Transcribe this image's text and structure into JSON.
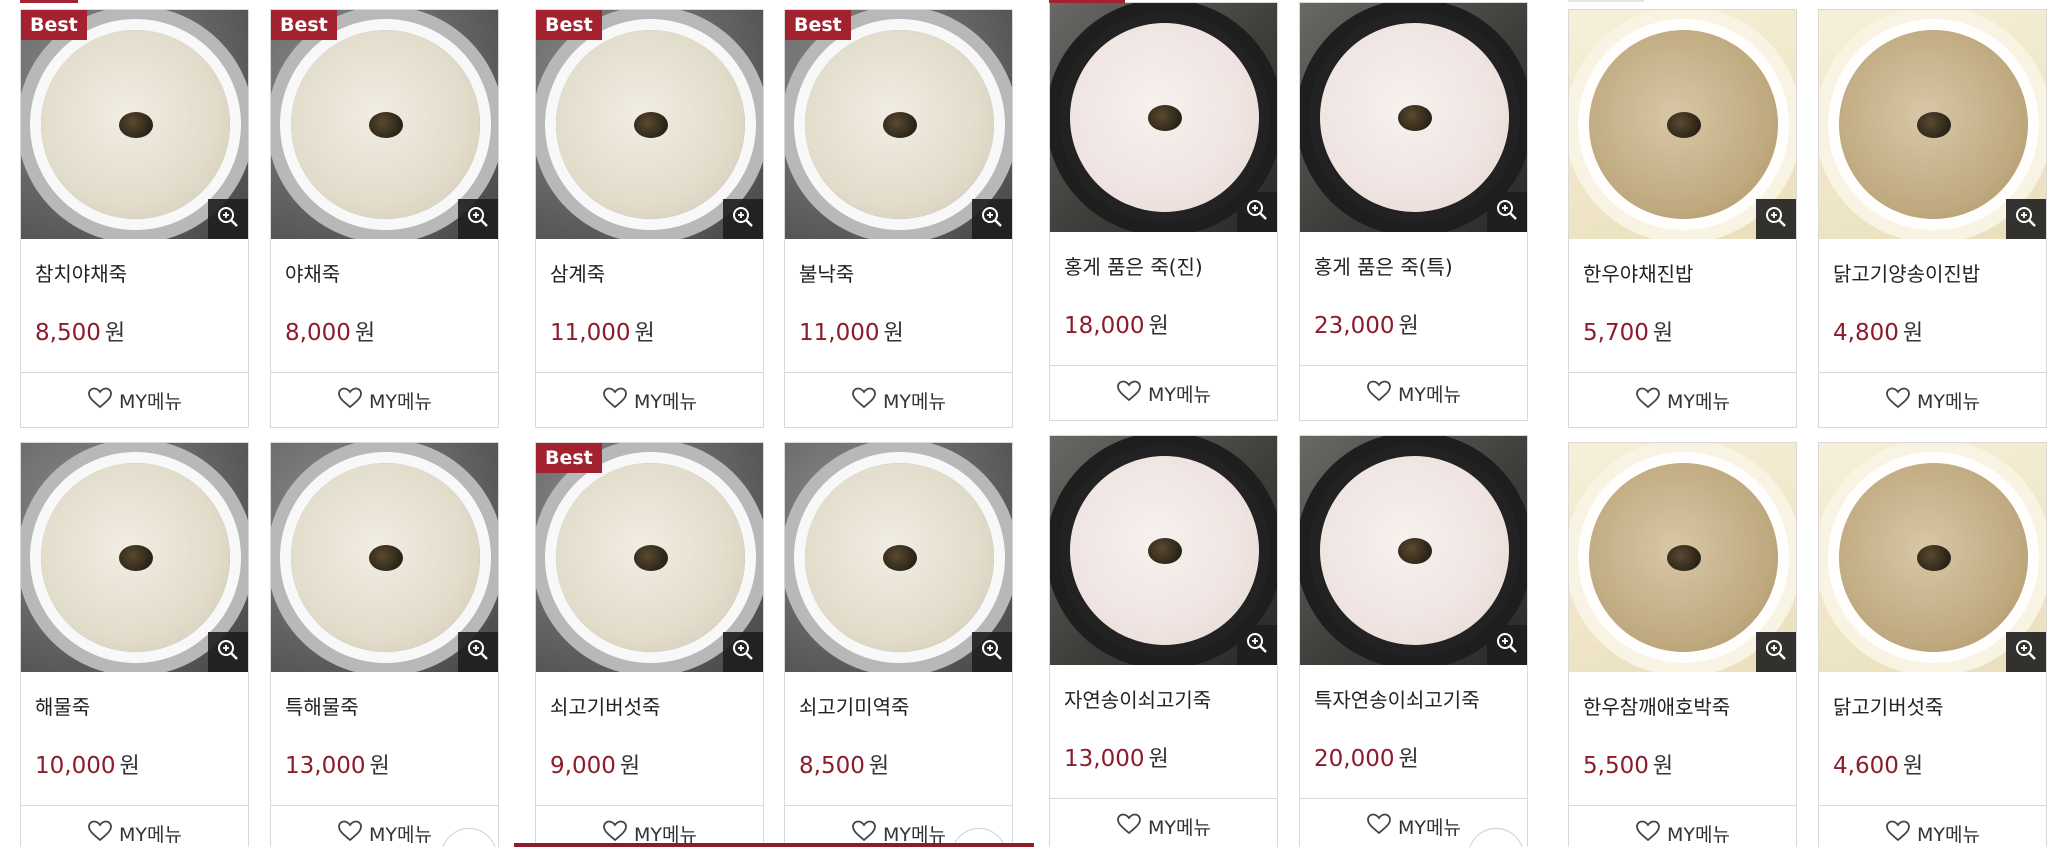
{
  "best_label": "Best",
  "my_menu_label": "MY메뉴",
  "currency": "원",
  "colors": {
    "price": "#8c1c2b",
    "badge": "#a3222f",
    "border": "#d9d9d9"
  },
  "groups": [
    {
      "products": [
        {
          "name": "참치야채죽",
          "price": "8,500",
          "best": true,
          "theme": "gray"
        },
        {
          "name": "야채죽",
          "price": "8,000",
          "best": true,
          "theme": "gray"
        },
        {
          "name": "해물죽",
          "price": "10,000",
          "best": false,
          "theme": "gray"
        },
        {
          "name": "특해물죽",
          "price": "13,000",
          "best": false,
          "theme": "gray"
        }
      ]
    },
    {
      "products": [
        {
          "name": "삼계죽",
          "price": "11,000",
          "best": true,
          "theme": "gray"
        },
        {
          "name": "불낙죽",
          "price": "11,000",
          "best": true,
          "theme": "gray"
        },
        {
          "name": "쇠고기버섯죽",
          "price": "9,000",
          "best": true,
          "theme": "gray"
        },
        {
          "name": "쇠고기미역죽",
          "price": "8,500",
          "best": false,
          "theme": "gray"
        }
      ]
    },
    {
      "products": [
        {
          "name": "홍게 품은 죽(진)",
          "price": "18,000",
          "best": false,
          "theme": "dark"
        },
        {
          "name": "홍게 품은 죽(특)",
          "price": "23,000",
          "best": false,
          "theme": "dark"
        },
        {
          "name": "자연송이쇠고기죽",
          "price": "13,000",
          "best": false,
          "theme": "dark"
        },
        {
          "name": "특자연송이쇠고기죽",
          "price": "20,000",
          "best": false,
          "theme": "dark"
        }
      ]
    },
    {
      "products": [
        {
          "name": "한우야채진밥",
          "price": "5,700",
          "best": false,
          "theme": "cream"
        },
        {
          "name": "닭고기양송이진밥",
          "price": "4,800",
          "best": false,
          "theme": "cream"
        },
        {
          "name": "한우참깨애호박죽",
          "price": "5,500",
          "best": false,
          "theme": "cream"
        },
        {
          "name": "닭고기버섯죽",
          "price": "4,600",
          "best": false,
          "theme": "cream"
        }
      ]
    }
  ]
}
